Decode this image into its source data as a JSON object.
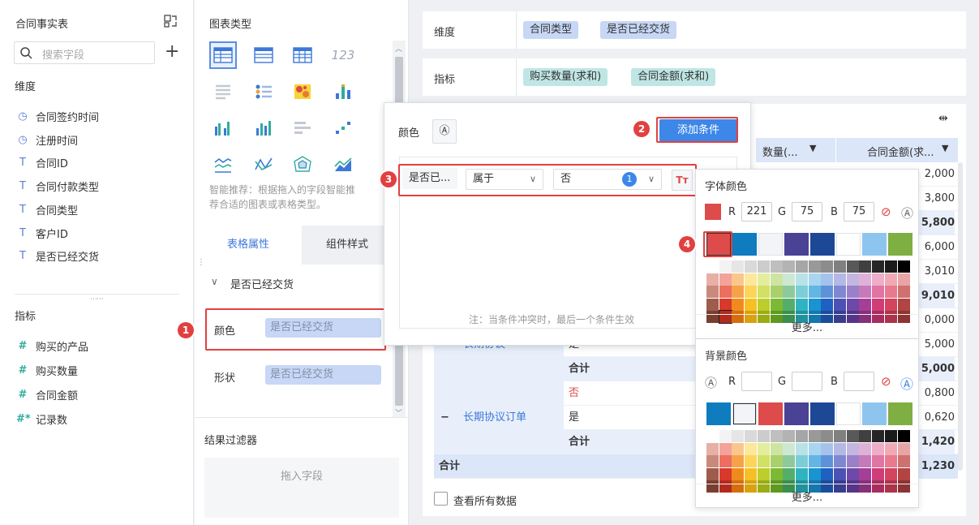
{
  "left_panel": {
    "title": "合同事实表",
    "search_placeholder": "搜索字段",
    "dimensions_label": "维度",
    "dimensions": [
      {
        "icon": "clock-icon",
        "label": "合同签约时间"
      },
      {
        "icon": "clock-icon",
        "label": "注册时间"
      },
      {
        "icon": "text-icon",
        "label": "合同ID"
      },
      {
        "icon": "text-icon",
        "label": "合同付款类型"
      },
      {
        "icon": "text-icon",
        "label": "合同类型"
      },
      {
        "icon": "text-icon",
        "label": "客户ID"
      },
      {
        "icon": "text-icon",
        "label": "是否已经交货"
      }
    ],
    "measures_label": "指标",
    "measures": [
      {
        "icon": "hash-icon",
        "label": "购买的产品"
      },
      {
        "icon": "hash-icon",
        "label": "购买数量"
      },
      {
        "icon": "hash-icon",
        "label": "合同金额"
      },
      {
        "icon": "hash-star-icon",
        "label": "记录数"
      }
    ]
  },
  "chart_panel": {
    "title": "图表类型",
    "recommend_text_line1": "智能推荐：根据拖入的字段智能推",
    "recommend_text_line2": "荐合适的图表或表格类型。",
    "tabs": [
      "表格属性",
      "组件样式"
    ],
    "section_title": "是否已经交货",
    "props": [
      {
        "label": "颜色",
        "value": "是否已经交货"
      },
      {
        "label": "形状",
        "value": "是否已经交货"
      }
    ],
    "filter_title": "结果过滤器",
    "filter_drop": "拖入字段"
  },
  "top_bar": {
    "dimension_label": "维度",
    "dimension_pills": [
      "合同类型",
      "是否已经交货"
    ],
    "measure_label": "指标",
    "measure_pills": [
      "购买数量(求和)",
      "合同金额(求和)"
    ]
  },
  "popup": {
    "color_label": "颜色",
    "add_condition": "添加条件",
    "cond_field": "是否已...",
    "cond_op": "属于",
    "cond_value": "否",
    "cond_count": "1",
    "note": "注：当条件冲突时，最后一个条件生效"
  },
  "font_color": {
    "title": "字体颜色",
    "r": "221",
    "g": "75",
    "b": "75",
    "r_label": "R",
    "g_label": "G",
    "b_label": "B",
    "current": "#dd4b4b",
    "more": "更多..."
  },
  "bg_color": {
    "title": "背景颜色",
    "r_label": "R",
    "g_label": "G",
    "b_label": "B",
    "more": "更多..."
  },
  "palette_main": [
    "#dd4b4b",
    "#0e7cbf",
    "#f2f4f7",
    "#4a4294",
    "#1d4896",
    "#ffffff",
    "#8ec5ee",
    "#7fae43"
  ],
  "palette_bg_main": [
    "#0e7cbf",
    "#f2f4f7",
    "#dd4b4b",
    "#4a4294",
    "#1d4896",
    "#ffffff",
    "#8ec5ee",
    "#7fae43"
  ],
  "palette_grid": [
    [
      "#ffffff",
      "#f3f3f3",
      "#e6e6e6",
      "#d9d9d9",
      "#cccccc",
      "#bfbfbf",
      "#b3b3b3",
      "#a6a6a6",
      "#999999",
      "#8c8c8c",
      "#808080",
      "#595959",
      "#404040",
      "#262626",
      "#1a1a1a",
      "#000000"
    ],
    [
      "#e7b0a6",
      "#f3a39a",
      "#fbc68c",
      "#fde79a",
      "#e3ed9d",
      "#cfe4a2",
      "#cde8d2",
      "#b9e1e8",
      "#a8d5ef",
      "#a5c3ea",
      "#b3b8e5",
      "#c4b5e1",
      "#dfb1d9",
      "#efadc8",
      "#f2a9b6",
      "#e8a5a5"
    ],
    [
      "#c98a7c",
      "#ec6e60",
      "#f7a24a",
      "#fbd55a",
      "#d2e065",
      "#a9d06a",
      "#8ec99c",
      "#7ccdd6",
      "#63b6e4",
      "#5d92d8",
      "#7f87d1",
      "#9a80c9",
      "#c57ab9",
      "#e074a2",
      "#e87a8f",
      "#cf7171"
    ],
    [
      "#9e5c4c",
      "#d8392b",
      "#f18a1d",
      "#f6c025",
      "#bccd2c",
      "#7dba34",
      "#54ae6a",
      "#2fb3c1",
      "#1a94d0",
      "#1f61c2",
      "#4c52b3",
      "#6e49a9",
      "#a53f96",
      "#cf3c78",
      "#d3445e",
      "#b24444"
    ],
    [
      "#7a3e30",
      "#b22a1e",
      "#d56d0c",
      "#d9a10c",
      "#9bac14",
      "#5d9a1e",
      "#3a8e4e",
      "#1f929e",
      "#1477ad",
      "#1a4d9c",
      "#383e8f",
      "#55348a",
      "#86307a",
      "#a82c5f",
      "#ab334b",
      "#8e3333"
    ]
  ],
  "table": {
    "col1_header": "数量(...",
    "col2_header": "合同金额(求...",
    "rows": [
      {
        "label": "",
        "sub": "",
        "v2": "2,000",
        "bold": false
      },
      {
        "label": "",
        "sub": "",
        "v2": "3,800",
        "bold": false
      },
      {
        "label": "",
        "sub": "",
        "v2": "5,800",
        "bold": true
      },
      {
        "label": "",
        "sub": "",
        "v2": "6,000",
        "bold": false
      },
      {
        "label": "",
        "sub": "",
        "v2": "3,010",
        "bold": false
      },
      {
        "label": "",
        "sub": "",
        "v2": "9,010",
        "bold": true
      },
      {
        "label": "",
        "sub": "",
        "v2": "0,000",
        "bold": false
      },
      {
        "label": "长期协议",
        "sub": "是",
        "v2": "5,000",
        "bold": false
      },
      {
        "label": "",
        "sub": "合计",
        "v2": "5,000",
        "bold": true
      },
      {
        "label": "",
        "sub": "否",
        "v2": "0,800",
        "bold": false
      },
      {
        "label": "长期协议订单",
        "sub": "是",
        "v2": "0,620",
        "bold": false
      },
      {
        "label": "",
        "sub": "合计",
        "v2": "1,420",
        "bold": true
      },
      {
        "label": "合计",
        "sub": "",
        "v2": "1,230",
        "bold": true
      }
    ],
    "view_all": "查看所有数据"
  },
  "badges": [
    "1",
    "2",
    "3",
    "4"
  ]
}
